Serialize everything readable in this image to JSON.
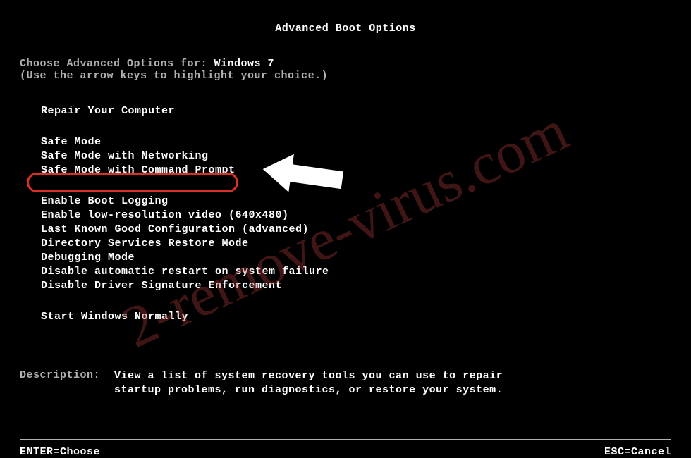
{
  "title": "Advanced Boot Options",
  "intro": {
    "prefix": "Choose Advanced Options for: ",
    "os": "Windows 7",
    "hint": "(Use the arrow keys to highlight your choice.)"
  },
  "menu": {
    "group1": [
      "Repair Your Computer"
    ],
    "group2": [
      "Safe Mode",
      "Safe Mode with Networking",
      "Safe Mode with Command Prompt"
    ],
    "group3": [
      "Enable Boot Logging",
      "Enable low-resolution video (640x480)",
      "Last Known Good Configuration (advanced)",
      "Directory Services Restore Mode",
      "Debugging Mode",
      "Disable automatic restart on system failure",
      "Disable Driver Signature Enforcement"
    ],
    "group4": [
      "Start Windows Normally"
    ],
    "highlighted_index": 2
  },
  "description": {
    "label": "Description:",
    "text": "View a list of system recovery tools you can use to repair startup problems, run diagnostics, or restore your system."
  },
  "footer": {
    "left": "ENTER=Choose",
    "right": "ESC=Cancel"
  },
  "watermark": "2-remove-virus.com",
  "annotation": {
    "highlight_target": "Safe Mode with Command Prompt"
  }
}
